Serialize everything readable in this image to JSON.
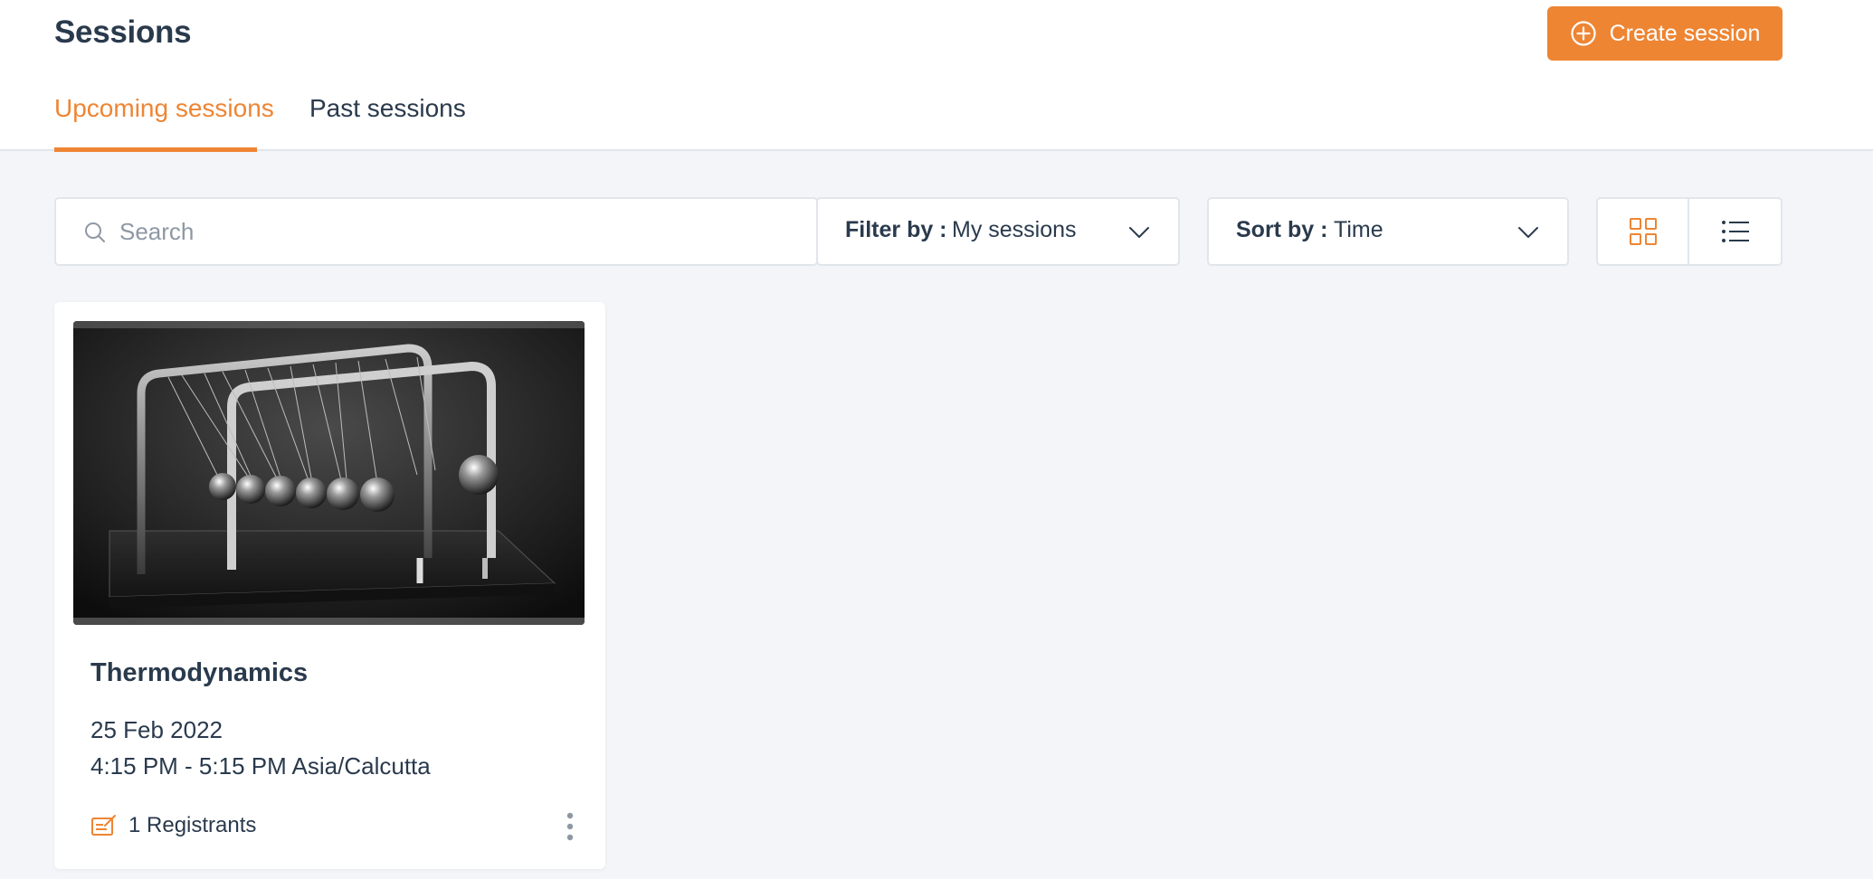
{
  "header": {
    "title": "Sessions",
    "create_button_label": "Create session"
  },
  "tabs": [
    {
      "label": "Upcoming sessions",
      "active": true
    },
    {
      "label": "Past sessions",
      "active": false
    }
  ],
  "toolbar": {
    "search_placeholder": "Search",
    "search_value": "",
    "filter_label": "Filter by :",
    "filter_value": "My sessions",
    "sort_label": "Sort by :",
    "sort_value": "Time",
    "view_modes": [
      {
        "name": "grid",
        "active": true
      },
      {
        "name": "list",
        "active": false
      }
    ]
  },
  "sessions": [
    {
      "title": "Thermodynamics",
      "date": "25 Feb 2022",
      "time": "4:15 PM - 5:15 PM Asia/Calcutta",
      "registrants": "1 Registrants"
    }
  ],
  "colors": {
    "accent": "#ee8533",
    "text": "#2a3a4d",
    "background": "#f3f5f8",
    "border": "#e1e6ec"
  },
  "icons": {
    "create": "plus-circle-icon",
    "search": "search-icon",
    "dropdown": "chevron-down-icon",
    "grid": "grid-icon",
    "list": "list-icon",
    "registrants": "edit-note-icon",
    "more": "kebab-menu-icon"
  }
}
